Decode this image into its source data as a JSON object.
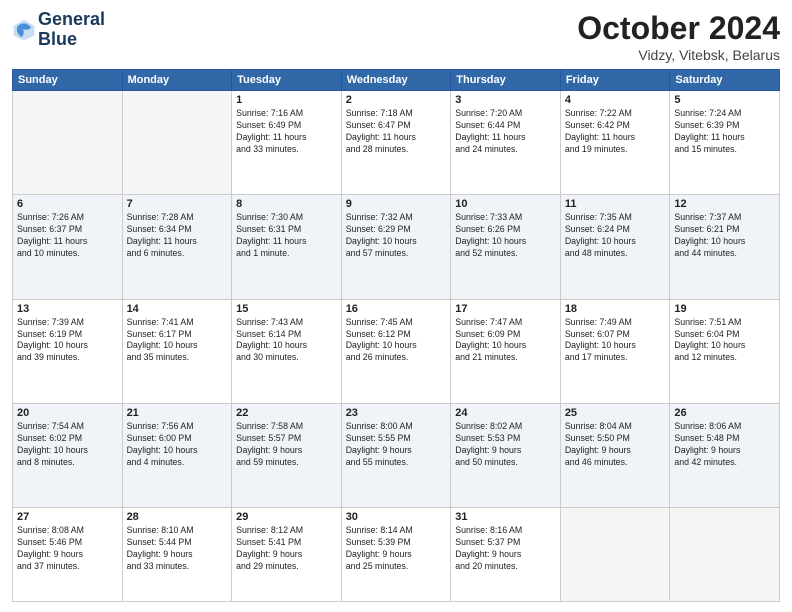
{
  "header": {
    "logo_line1": "General",
    "logo_line2": "Blue",
    "month": "October 2024",
    "location": "Vidzy, Vitebsk, Belarus"
  },
  "weekdays": [
    "Sunday",
    "Monday",
    "Tuesday",
    "Wednesday",
    "Thursday",
    "Friday",
    "Saturday"
  ],
  "weeks": [
    [
      {
        "day": "",
        "info": ""
      },
      {
        "day": "",
        "info": ""
      },
      {
        "day": "1",
        "info": "Sunrise: 7:16 AM\nSunset: 6:49 PM\nDaylight: 11 hours\nand 33 minutes."
      },
      {
        "day": "2",
        "info": "Sunrise: 7:18 AM\nSunset: 6:47 PM\nDaylight: 11 hours\nand 28 minutes."
      },
      {
        "day": "3",
        "info": "Sunrise: 7:20 AM\nSunset: 6:44 PM\nDaylight: 11 hours\nand 24 minutes."
      },
      {
        "day": "4",
        "info": "Sunrise: 7:22 AM\nSunset: 6:42 PM\nDaylight: 11 hours\nand 19 minutes."
      },
      {
        "day": "5",
        "info": "Sunrise: 7:24 AM\nSunset: 6:39 PM\nDaylight: 11 hours\nand 15 minutes."
      }
    ],
    [
      {
        "day": "6",
        "info": "Sunrise: 7:26 AM\nSunset: 6:37 PM\nDaylight: 11 hours\nand 10 minutes."
      },
      {
        "day": "7",
        "info": "Sunrise: 7:28 AM\nSunset: 6:34 PM\nDaylight: 11 hours\nand 6 minutes."
      },
      {
        "day": "8",
        "info": "Sunrise: 7:30 AM\nSunset: 6:31 PM\nDaylight: 11 hours\nand 1 minute."
      },
      {
        "day": "9",
        "info": "Sunrise: 7:32 AM\nSunset: 6:29 PM\nDaylight: 10 hours\nand 57 minutes."
      },
      {
        "day": "10",
        "info": "Sunrise: 7:33 AM\nSunset: 6:26 PM\nDaylight: 10 hours\nand 52 minutes."
      },
      {
        "day": "11",
        "info": "Sunrise: 7:35 AM\nSunset: 6:24 PM\nDaylight: 10 hours\nand 48 minutes."
      },
      {
        "day": "12",
        "info": "Sunrise: 7:37 AM\nSunset: 6:21 PM\nDaylight: 10 hours\nand 44 minutes."
      }
    ],
    [
      {
        "day": "13",
        "info": "Sunrise: 7:39 AM\nSunset: 6:19 PM\nDaylight: 10 hours\nand 39 minutes."
      },
      {
        "day": "14",
        "info": "Sunrise: 7:41 AM\nSunset: 6:17 PM\nDaylight: 10 hours\nand 35 minutes."
      },
      {
        "day": "15",
        "info": "Sunrise: 7:43 AM\nSunset: 6:14 PM\nDaylight: 10 hours\nand 30 minutes."
      },
      {
        "day": "16",
        "info": "Sunrise: 7:45 AM\nSunset: 6:12 PM\nDaylight: 10 hours\nand 26 minutes."
      },
      {
        "day": "17",
        "info": "Sunrise: 7:47 AM\nSunset: 6:09 PM\nDaylight: 10 hours\nand 21 minutes."
      },
      {
        "day": "18",
        "info": "Sunrise: 7:49 AM\nSunset: 6:07 PM\nDaylight: 10 hours\nand 17 minutes."
      },
      {
        "day": "19",
        "info": "Sunrise: 7:51 AM\nSunset: 6:04 PM\nDaylight: 10 hours\nand 12 minutes."
      }
    ],
    [
      {
        "day": "20",
        "info": "Sunrise: 7:54 AM\nSunset: 6:02 PM\nDaylight: 10 hours\nand 8 minutes."
      },
      {
        "day": "21",
        "info": "Sunrise: 7:56 AM\nSunset: 6:00 PM\nDaylight: 10 hours\nand 4 minutes."
      },
      {
        "day": "22",
        "info": "Sunrise: 7:58 AM\nSunset: 5:57 PM\nDaylight: 9 hours\nand 59 minutes."
      },
      {
        "day": "23",
        "info": "Sunrise: 8:00 AM\nSunset: 5:55 PM\nDaylight: 9 hours\nand 55 minutes."
      },
      {
        "day": "24",
        "info": "Sunrise: 8:02 AM\nSunset: 5:53 PM\nDaylight: 9 hours\nand 50 minutes."
      },
      {
        "day": "25",
        "info": "Sunrise: 8:04 AM\nSunset: 5:50 PM\nDaylight: 9 hours\nand 46 minutes."
      },
      {
        "day": "26",
        "info": "Sunrise: 8:06 AM\nSunset: 5:48 PM\nDaylight: 9 hours\nand 42 minutes."
      }
    ],
    [
      {
        "day": "27",
        "info": "Sunrise: 8:08 AM\nSunset: 5:46 PM\nDaylight: 9 hours\nand 37 minutes."
      },
      {
        "day": "28",
        "info": "Sunrise: 8:10 AM\nSunset: 5:44 PM\nDaylight: 9 hours\nand 33 minutes."
      },
      {
        "day": "29",
        "info": "Sunrise: 8:12 AM\nSunset: 5:41 PM\nDaylight: 9 hours\nand 29 minutes."
      },
      {
        "day": "30",
        "info": "Sunrise: 8:14 AM\nSunset: 5:39 PM\nDaylight: 9 hours\nand 25 minutes."
      },
      {
        "day": "31",
        "info": "Sunrise: 8:16 AM\nSunset: 5:37 PM\nDaylight: 9 hours\nand 20 minutes."
      },
      {
        "day": "",
        "info": ""
      },
      {
        "day": "",
        "info": ""
      }
    ]
  ]
}
